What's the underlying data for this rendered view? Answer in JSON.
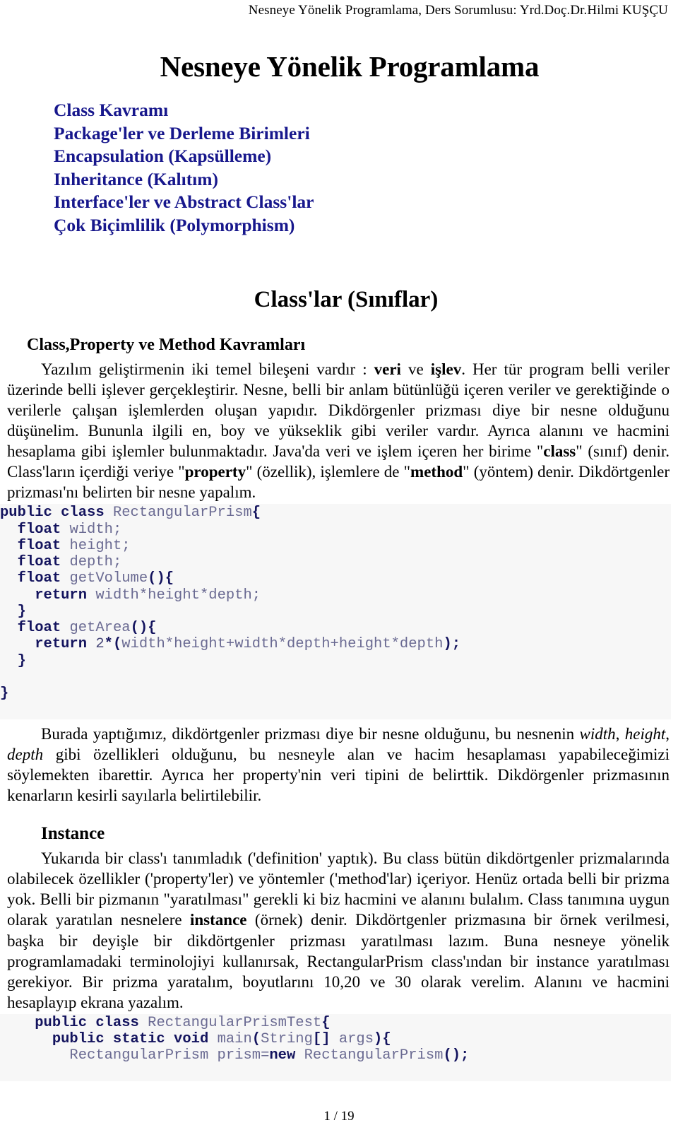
{
  "header": {
    "running_head": "Nesneye Yönelik Programlama,  Ders Sorumlusu: Yrd.Doç.Dr.Hilmi KUŞÇU"
  },
  "title": "Nesneye Yönelik Programlama",
  "topics": [
    "Class Kavramı",
    "Package'ler ve Derleme Birimleri",
    "Encapsulation (Kapsülleme)",
    "Inheritance (Kalıtım)",
    "Interface'ler ve Abstract Class'lar",
    "Çok Biçimlilik (Polymorphism)"
  ],
  "sections": {
    "classlar_title": "Class'lar (Sınıflar)",
    "class_property_method_title": "Class,Property ve Method Kavramları",
    "instance_title": "Instance"
  },
  "paragraphs": {
    "intro": {
      "part1": "Yazılım geliştirmenin iki temel bileşeni vardır : ",
      "bold1": "veri",
      "part2": " ve ",
      "bold2": "işlev",
      "part3": ". Her tür program belli veriler üzerinde belli işlever gerçekleştirir. Nesne, belli bir anlam bütünlüğü içeren veriler ve gerektiğinde o verilerle çalışan işlemlerden oluşan yapıdır. Dikdörgenler prizması diye bir nesne olduğunu düşünelim. Bununla ilgili en, boy ve yükseklik gibi veriler vardır. Ayrıca alanını ve hacmini hesaplama gibi işlemler bulunmaktadır. Java'da veri ve işlem içeren her birime \"",
      "bold3": "class",
      "part4": "\" (sınıf) denir. Class'ların içerdiği veriye \"",
      "bold4": "property",
      "part5": "\" (özellik), işlemlere de \"",
      "bold5": "method",
      "part6": "\" (yöntem) denir. Dikdörtgenler prizması'nı belirten bir nesne yapalım."
    },
    "after_code": {
      "part1": "Burada yaptığımız, dikdörtgenler prizması diye bir nesne olduğunu, bu nesnenin ",
      "italic1": "width",
      "part2": ", ",
      "italic2": "height",
      "part3": ", ",
      "italic3": "depth",
      "part4": " gibi özellikleri olduğunu, bu nesneyle alan ve hacim hesaplaması yapabileceğimizi söylemekten ibarettir. Ayrıca her property'nin veri tipini de belirttik. Dikdörgenler prizmasının kenarların kesirli sayılarla belirtilebilir."
    },
    "instance_body": {
      "part1": "Yukarıda bir class'ı tanımladık ('definition' yaptık). Bu class bütün dikdörtgenler prizmalarında olabilecek özellikler ('property'ler) ve yöntemler ('method'lar) içeriyor. Henüz ortada belli bir prizma yok. Belli bir pizmanın \"yaratılması\" gerekli ki biz hacmini ve alanını bulalım. Class tanımına uygun olarak yaratılan nesnelere ",
      "bold1": "instance",
      "part2": " (örnek) denir. Dikdörtgenler prizmasına bir örnek verilmesi, başka bir deyişle bir dikdörtgenler prizması yaratılması lazım. Buna nesneye yönelik programlamadaki terminolojiyi kullanırsak, RectangularPrism class'ından bir instance yaratılması gerekiyor. Bir prizma yaratalım, boyutlarını 10,20 ve 30 olarak verelim. Alanını ve hacmini hesaplayıp ekrana yazalım."
    }
  },
  "code_blocks": {
    "rectangular_prism": [
      "public class RectangularPrism{",
      "  float width;",
      "  float height;",
      "  float depth;",
      "  float getVolume(){",
      "    return width*height*depth;",
      "  }",
      "  float getArea(){",
      "    return 2*(width*height+width*depth+height*depth);",
      "  }",
      "",
      "}"
    ],
    "rectangular_prism_test": [
      "    public class RectangularPrismTest{",
      "      public static void main(String[] args){",
      "        RectangularPrism prism=new RectangularPrism();"
    ]
  },
  "footer": {
    "page_number": "1 / 19"
  },
  "colors": {
    "topic_navy": "#17178c",
    "code_keyword": "#14145e",
    "code_identifier": "#6a6a92",
    "code_background": "#f7f7f7"
  }
}
